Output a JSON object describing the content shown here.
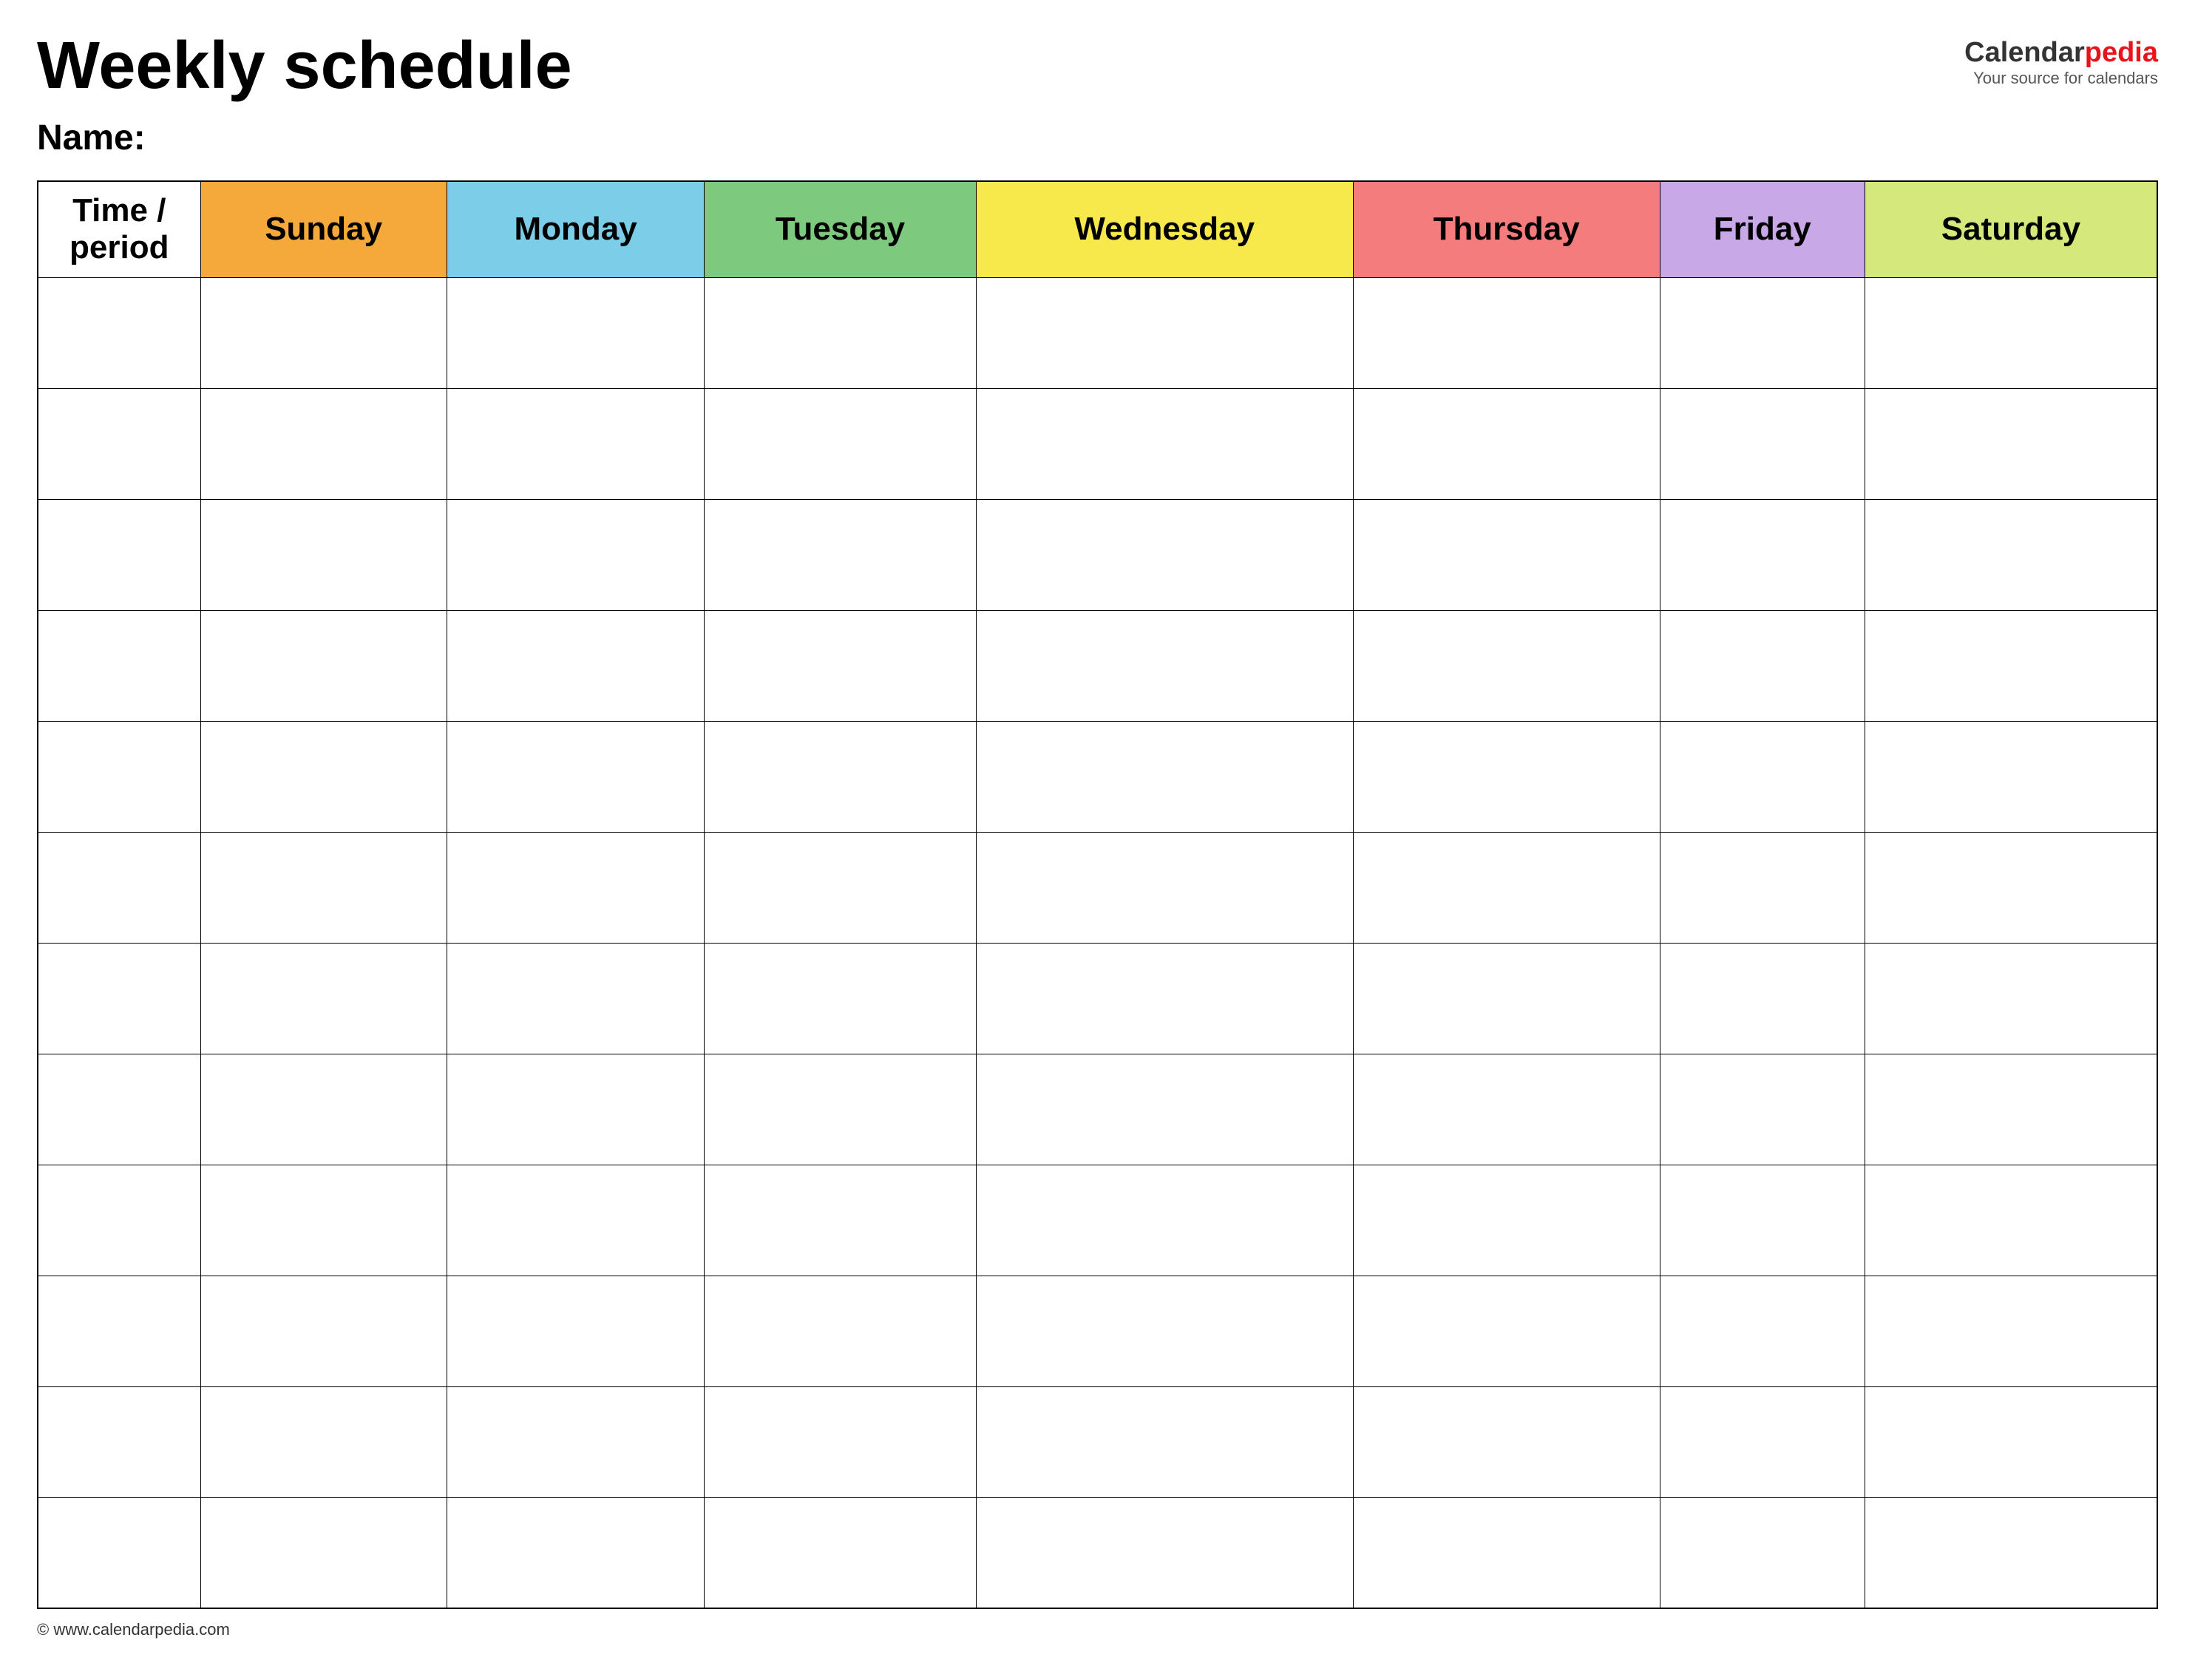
{
  "header": {
    "title": "Weekly schedule",
    "brand": {
      "calendar": "Calendar",
      "pedia": "pedia",
      "tagline": "Your source for calendars"
    },
    "name_label": "Name:"
  },
  "table": {
    "columns": [
      {
        "id": "time",
        "label": "Time / period",
        "colorClass": "col-time"
      },
      {
        "id": "sunday",
        "label": "Sunday",
        "colorClass": "col-sunday"
      },
      {
        "id": "monday",
        "label": "Monday",
        "colorClass": "col-monday"
      },
      {
        "id": "tuesday",
        "label": "Tuesday",
        "colorClass": "col-tuesday"
      },
      {
        "id": "wednesday",
        "label": "Wednesday",
        "colorClass": "col-wednesday"
      },
      {
        "id": "thursday",
        "label": "Thursday",
        "colorClass": "col-thursday"
      },
      {
        "id": "friday",
        "label": "Friday",
        "colorClass": "col-friday"
      },
      {
        "id": "saturday",
        "label": "Saturday",
        "colorClass": "col-saturday"
      }
    ],
    "row_count": 12
  },
  "footer": {
    "url": "© www.calendarpedia.com"
  }
}
